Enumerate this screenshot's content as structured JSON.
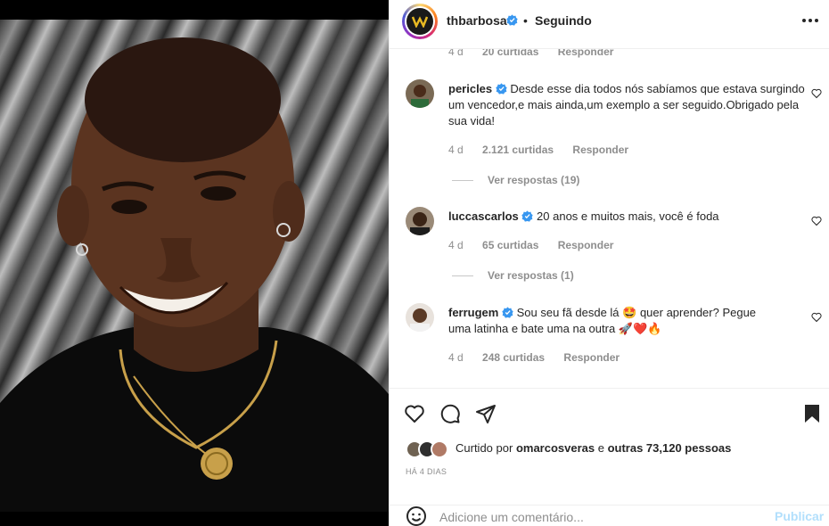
{
  "post": {
    "author": "thbarbosa",
    "follow_dot": "•",
    "follow_status": "Seguindo",
    "photo_alt": "Post photo"
  },
  "comments": [
    {
      "meta_time": "4 d",
      "meta_likes": "20 curtidas",
      "meta_reply": "Responder"
    },
    {
      "username": "pericles",
      "text": "Desde esse dia todos nós sabíamos que estava surgindo um vencedor,e mais ainda,um exemplo a ser seguido.Obrigado pela sua vida!",
      "time": "4 d",
      "likes": "2.121 curtidas",
      "reply": "Responder",
      "view_replies": "Ver respostas (19)"
    },
    {
      "username": "luccascarlos",
      "text": "20 anos e muitos mais, você é foda",
      "time": "4 d",
      "likes": "65 curtidas",
      "reply": "Responder",
      "view_replies": "Ver respostas (1)"
    },
    {
      "username": "ferrugem",
      "text_part1": "Sou seu fã desde lá 🤩 quer aprender? Pegue",
      "text_part2": "uma latinha e bate uma na outra 🚀❤️🔥",
      "time": "4 d",
      "likes": "248 curtidas",
      "reply": "Responder"
    }
  ],
  "likes_summary": {
    "prefix": "Curtido por",
    "user": "omarcosveras",
    "connector": "e",
    "others": "outras 73,120 pessoas"
  },
  "posted_time": "HÁ 4 DIAS",
  "comment_box": {
    "placeholder": "Adicione um comentário...",
    "publish": "Publicar"
  },
  "icons": [
    "verified-icon",
    "more-icon",
    "heart-icon",
    "comment-icon",
    "share-icon",
    "bookmark-icon",
    "emoji-icon"
  ],
  "colors": {
    "verified": "#3897f0",
    "publish_disabled": "#b2dffc",
    "secondary_text": "#8e8e8e"
  }
}
